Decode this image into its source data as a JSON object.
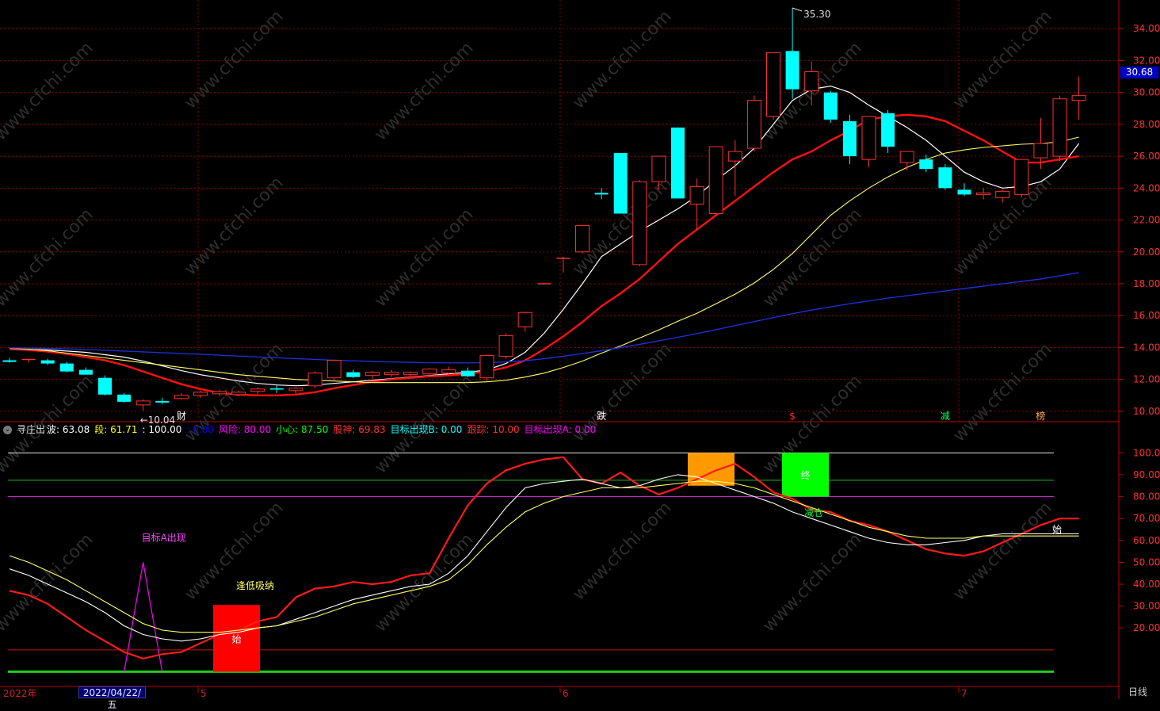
{
  "chart_data": [
    {
      "type": "candlestick",
      "y_axis_ticks": [
        "34.00",
        "32.00",
        "30.00",
        "28.00",
        "26.00",
        "24.00",
        "22.00",
        "20.00",
        "18.00",
        "16.00",
        "14.00",
        "12.00",
        "10.00"
      ],
      "ylim": [
        9.4,
        35.6
      ],
      "last_price": "30.68",
      "high_label": "35.30",
      "low_label": "←10.04",
      "high_value": 35.3,
      "low_value": 10.04,
      "candles": [
        [
          13.2,
          13.35,
          13.05,
          13.1
        ],
        [
          13.2,
          13.3,
          13.05,
          13.25
        ],
        [
          13.2,
          13.3,
          12.9,
          13.0
        ],
        [
          13.0,
          13.1,
          12.45,
          12.5
        ],
        [
          12.6,
          12.75,
          12.3,
          12.3
        ],
        [
          12.1,
          12.25,
          11.0,
          11.05
        ],
        [
          11.05,
          11.15,
          10.55,
          10.6
        ],
        [
          10.4,
          10.75,
          10.04,
          10.65
        ],
        [
          10.65,
          10.85,
          10.45,
          10.55
        ],
        [
          10.8,
          11.15,
          10.75,
          11.0
        ],
        [
          11.0,
          11.3,
          10.85,
          11.2
        ],
        [
          11.1,
          11.35,
          10.95,
          11.25
        ],
        [
          11.05,
          11.3,
          10.95,
          11.2
        ],
        [
          11.25,
          11.5,
          11.05,
          11.4
        ],
        [
          11.4,
          11.65,
          11.15,
          11.35
        ],
        [
          11.3,
          11.5,
          11.1,
          11.45
        ],
        [
          11.6,
          12.5,
          11.45,
          12.4
        ],
        [
          12.1,
          13.25,
          11.9,
          13.2
        ],
        [
          12.45,
          12.6,
          12.1,
          12.15
        ],
        [
          12.25,
          12.55,
          12.05,
          12.45
        ],
        [
          12.3,
          12.6,
          12.15,
          12.45
        ],
        [
          12.3,
          12.5,
          12.15,
          12.45
        ],
        [
          12.35,
          12.7,
          12.2,
          12.65
        ],
        [
          12.4,
          12.8,
          12.25,
          12.6
        ],
        [
          12.55,
          12.75,
          12.15,
          12.2
        ],
        [
          12.1,
          13.55,
          11.9,
          13.5
        ],
        [
          13.45,
          14.9,
          13.3,
          14.75
        ],
        [
          15.3,
          16.25,
          15.0,
          16.2
        ],
        [
          18.0,
          18.0,
          18.0,
          18.0
        ],
        [
          19.6,
          19.7,
          18.7,
          19.6
        ],
        [
          20.0,
          21.7,
          19.9,
          21.65
        ],
        [
          23.7,
          24.0,
          23.3,
          23.6
        ],
        [
          26.2,
          26.2,
          22.4,
          22.4
        ],
        [
          19.2,
          24.5,
          19.1,
          24.4
        ],
        [
          24.4,
          26.0,
          23.9,
          26.0
        ],
        [
          27.8,
          27.8,
          23.35,
          23.35
        ],
        [
          23.0,
          24.6,
          21.4,
          24.1
        ],
        [
          22.4,
          26.6,
          22.3,
          26.6
        ],
        [
          25.7,
          27.0,
          23.5,
          26.3
        ],
        [
          26.5,
          29.8,
          26.3,
          29.5
        ],
        [
          28.5,
          32.5,
          28.3,
          32.5
        ],
        [
          32.6,
          35.3,
          29.6,
          30.2
        ],
        [
          30.1,
          31.95,
          29.2,
          31.3
        ],
        [
          30.0,
          30.1,
          28.1,
          28.3
        ],
        [
          28.2,
          28.6,
          25.5,
          26.0
        ],
        [
          25.8,
          28.5,
          25.3,
          28.5
        ],
        [
          28.7,
          28.9,
          26.2,
          26.6
        ],
        [
          25.6,
          26.3,
          25.1,
          26.3
        ],
        [
          25.8,
          26.1,
          25.0,
          25.2
        ],
        [
          25.3,
          25.5,
          23.9,
          24.0
        ],
        [
          23.9,
          24.3,
          23.5,
          23.6
        ],
        [
          23.6,
          24.0,
          23.3,
          23.7
        ],
        [
          23.4,
          23.9,
          23.1,
          23.8
        ],
        [
          23.6,
          25.8,
          23.4,
          25.8
        ],
        [
          25.9,
          28.4,
          25.2,
          26.8
        ],
        [
          26.0,
          29.8,
          25.7,
          29.6
        ],
        [
          29.5,
          31.0,
          28.3,
          29.8
        ]
      ],
      "series": [
        {
          "values": [
            13.9,
            13.88,
            13.85,
            13.78,
            13.7,
            13.55,
            13.4,
            13.15,
            12.85,
            12.55,
            12.3,
            12.1,
            11.9,
            11.75,
            11.65,
            11.6,
            11.65,
            11.75,
            11.85,
            11.95,
            12.05,
            12.15,
            12.25,
            12.35,
            12.45,
            12.6,
            13.0,
            13.7,
            14.9,
            16.4,
            18.0,
            19.7,
            20.5,
            21.3,
            22.0,
            22.7,
            23.5,
            24.5,
            25.4,
            26.5,
            28.0,
            29.5,
            30.2,
            30.4,
            30.0,
            29.2,
            28.5,
            27.8,
            27.0,
            26.0,
            25.0,
            24.4,
            24.0,
            24.1,
            24.4,
            25.2,
            26.8
          ]
        },
        {
          "values": [
            13.9,
            13.85,
            13.75,
            13.6,
            13.4,
            13.2,
            12.9,
            12.5,
            12.1,
            11.7,
            11.4,
            11.15,
            11.05,
            11.0,
            11.0,
            11.05,
            11.2,
            11.45,
            11.65,
            11.85,
            12.0,
            12.1,
            12.2,
            12.25,
            12.35,
            12.5,
            12.75,
            13.2,
            13.9,
            14.7,
            15.6,
            16.6,
            17.4,
            18.3,
            19.4,
            20.5,
            21.4,
            22.3,
            23.2,
            24.1,
            25.0,
            25.8,
            26.3,
            27.0,
            27.6,
            28.3,
            28.5,
            28.6,
            28.5,
            28.2,
            27.6,
            27.0,
            26.3,
            25.6,
            25.6,
            25.8,
            26.0
          ]
        },
        {
          "values": [
            13.95,
            13.9,
            13.8,
            13.65,
            13.5,
            13.35,
            13.2,
            13.05,
            12.9,
            12.75,
            12.6,
            12.45,
            12.3,
            12.2,
            12.1,
            12.0,
            11.95,
            11.9,
            11.85,
            11.8,
            11.8,
            11.8,
            11.8,
            11.8,
            11.8,
            11.85,
            11.95,
            12.15,
            12.4,
            12.75,
            13.15,
            13.65,
            14.1,
            14.6,
            15.1,
            15.65,
            16.15,
            16.75,
            17.35,
            18.05,
            18.9,
            19.9,
            21.1,
            22.3,
            23.2,
            24.0,
            24.7,
            25.3,
            25.8,
            26.2,
            26.4,
            26.55,
            26.65,
            26.75,
            26.8,
            26.9,
            27.2
          ]
        },
        {
          "values": [
            13.98,
            13.97,
            13.95,
            13.92,
            13.88,
            13.83,
            13.78,
            13.73,
            13.68,
            13.63,
            13.58,
            13.52,
            13.46,
            13.41,
            13.36,
            13.31,
            13.26,
            13.21,
            13.17,
            13.13,
            13.1,
            13.07,
            13.05,
            13.04,
            13.04,
            13.06,
            13.1,
            13.18,
            13.3,
            13.45,
            13.62,
            13.8,
            14.0,
            14.2,
            14.42,
            14.64,
            14.88,
            15.12,
            15.38,
            15.63,
            15.88,
            16.12,
            16.35,
            16.55,
            16.75,
            16.92,
            17.1,
            17.25,
            17.4,
            17.55,
            17.7,
            17.85,
            18.0,
            18.15,
            18.3,
            18.5,
            18.7
          ]
        }
      ],
      "markers": [
        "财",
        "跌",
        "$",
        "减",
        "榜"
      ]
    },
    {
      "type": "line",
      "ylim": [
        -6,
        107
      ],
      "y_axis_ticks": [
        "100.00",
        "90.00",
        "80.00",
        "70.00",
        "60.00",
        "50.00",
        "40.00",
        "30.00",
        "20.00"
      ],
      "indicator": {
        "name": "寻庄出",
        "fields": [
          {
            "label": "波",
            "value": "63.08",
            "color": "#ffffff"
          },
          {
            "label": "段",
            "value": "61.71",
            "color": "#ffff00"
          },
          {
            "label": "",
            "value": "100.00",
            "color": "#ffffff"
          },
          {
            "label": "",
            "value": "0.00",
            "color": "#0000ff"
          },
          {
            "label": "风险",
            "value": "80.00",
            "color": "#ff00ff"
          },
          {
            "label": "小心",
            "value": "87.50",
            "color": "#00ff00"
          },
          {
            "label": "股神",
            "value": "69.83",
            "color": "#ff3030"
          },
          {
            "label": "目标出现B",
            "value": "0.00",
            "color": "#00ffff"
          },
          {
            "label": "跟踪",
            "value": "10.00",
            "color": "#ff3030"
          },
          {
            "label": "目标出现A",
            "value": "0.00",
            "color": "#ff00ff"
          }
        ]
      },
      "reference_lines": [
        100,
        87.5,
        80,
        10,
        0
      ],
      "series": [
        {
          "values": [
            37,
            35,
            31,
            25,
            19,
            14,
            9,
            6,
            8,
            9,
            13,
            17,
            19,
            23,
            25,
            34,
            38,
            39,
            41,
            40,
            41,
            44,
            45,
            61,
            76,
            86,
            92,
            95,
            97,
            98,
            88,
            86,
            91,
            85,
            81,
            84,
            88,
            92,
            95,
            89,
            82,
            79,
            74,
            73,
            69,
            67,
            64,
            60,
            56,
            54,
            53,
            55,
            59,
            63,
            67,
            70,
            70
          ]
        },
        {
          "values": [
            47,
            44,
            40,
            36,
            32,
            27,
            21,
            17,
            15,
            14,
            15,
            17,
            18,
            20,
            21,
            24,
            27,
            30,
            33,
            35,
            37,
            39,
            40,
            45,
            53,
            64,
            75,
            84,
            86,
            87,
            88,
            86,
            84,
            85,
            88,
            90,
            89,
            86,
            83,
            80,
            77,
            73,
            70,
            67,
            64,
            61,
            59,
            58,
            58,
            59,
            60,
            62,
            63,
            63,
            63,
            63,
            63
          ]
        },
        {
          "values": [
            53,
            50,
            46,
            42,
            37,
            32,
            27,
            22,
            19,
            18,
            18,
            18,
            19,
            20,
            21,
            23,
            25,
            28,
            31,
            33,
            35,
            37,
            39,
            42,
            49,
            58,
            66,
            73,
            77,
            80,
            82,
            84,
            84,
            84,
            85,
            86,
            87,
            87,
            86,
            84,
            81,
            78,
            75,
            72,
            69,
            66,
            64,
            62,
            61,
            61,
            61,
            62,
            62,
            62,
            62,
            62,
            62
          ]
        }
      ],
      "spike": {
        "label": "目标A出现",
        "value": 50
      },
      "blocks": [
        {
          "label": "始",
          "bottom": 0,
          "top": 30.5,
          "color": "#ff0000"
        },
        {
          "label": "",
          "bottom": 85,
          "top": 100,
          "color": "#ff9900"
        },
        {
          "label": "终",
          "bottom": 80,
          "top": 100,
          "color": "#00ff00"
        }
      ],
      "annotations": [
        "逢低吸纳",
        "减仓",
        "始"
      ]
    }
  ],
  "x_axis": {
    "year": "2022年",
    "months": [
      "5",
      "6",
      "7"
    ]
  },
  "cursor_date": "2022/04/22/五",
  "period_label": "日线",
  "watermark": "www.cfchi.com",
  "colors": {
    "up": "#ff3030",
    "down": "#00ffff",
    "ma5": "#ffffff",
    "ma10": "#ff1010",
    "ma20": "#ffff66",
    "ma60": "#1e2ed0",
    "grid": "#8b0000",
    "axis": "#c00000"
  }
}
